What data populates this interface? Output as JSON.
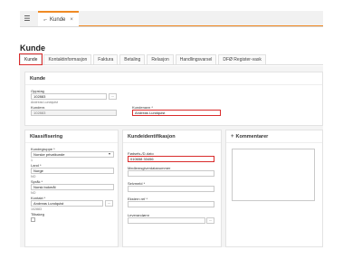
{
  "topbar": {
    "menu_icon": "hamburger-icon",
    "tab_label": "Kunde",
    "tab_close": "×"
  },
  "page_title": "Kunde",
  "tabs": [
    "Kunde",
    "Kontaktinformasjon",
    "Faktura",
    "Betaling",
    "Relasjon",
    "Handlingsvarsel",
    "DFØ Register-vask"
  ],
  "kunde_panel": {
    "title": "Kunde",
    "oppslag_label": "Oppslag",
    "oppslag_value": "102883",
    "oppslag_sub": "Andreas Lundquist",
    "kundenr_label": "Kundenr.",
    "kundenr_value": "102883",
    "kundenavn_label": "Kundenavn *",
    "kundenavn_value": "Andreas Lundquist"
  },
  "klassifisering": {
    "title": "Klassifisering",
    "kategori_label": "Kundegruppe *",
    "kategori_value": "Norske privatkunde",
    "kategori_sub": "1",
    "land_label": "Land *",
    "land_value": "Norge",
    "land_sub": "NO",
    "sprak_label": "Språk *",
    "sprak_value": "Norsk bokmål",
    "sprak_sub": "NO",
    "kontakt_label": "Kontakt *",
    "kontakt_value": "Andreas Lundquist",
    "kontakt_sub": "102883",
    "tilbakeg_label": "Tilbakeg"
  },
  "identifikasjon": {
    "title": "Kundeidentifikasjon",
    "fodsel_label": "Fødsels-/D-dato",
    "fodsel_value": "010658 33456",
    "medlem_label": "Medlemsgiverdatanummer",
    "selvmeld_label": "Selvmeld *",
    "ekstern_label": "Ekstern ref *",
    "leverandor_label": "Leverandørnr"
  },
  "kommentarer": {
    "title": "Kommentarer",
    "plus": "+"
  },
  "colors": {
    "highlight": "#d92b2b",
    "accent": "#f08a24"
  }
}
